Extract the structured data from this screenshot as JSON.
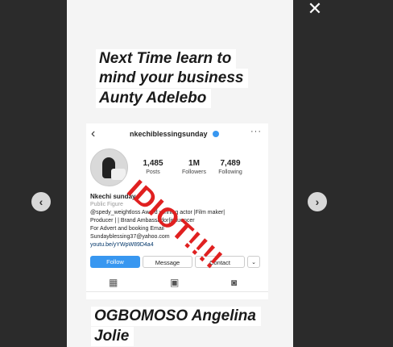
{
  "story": {
    "caption_top": [
      "Next Time learn to",
      "mind your business",
      "Aunty Adelebo"
    ],
    "caption_bottom": [
      "OGBOMOSO Angelina",
      "Jolie"
    ],
    "stamp_text": "IDIOT!!!!"
  },
  "profile": {
    "handle": "nkechiblessingsunday",
    "back_glyph": "‹",
    "more_glyph": "···",
    "stats": [
      {
        "value": "1,485",
        "label": "Posts"
      },
      {
        "value": "1M",
        "label": "Followers"
      },
      {
        "value": "7,489",
        "label": "Following"
      }
    ],
    "name": "Nkechi sunday",
    "category": "Public Figure",
    "bio_lines": [
      "@spedy_weightloss Award winning actor |Film maker|",
      "Producer |  | Brand Ambassador|influencer",
      "For Advert and booking Email",
      "Sundayblessing37@yahoo.com"
    ],
    "link": "youtu.be/yYWpW89D4a4",
    "buttons": {
      "follow": "Follow",
      "message": "Message",
      "contact": "Contact",
      "more": "⌄"
    },
    "tabs": {
      "grid": "▦",
      "igtv": "▣",
      "tagged": "◙"
    }
  },
  "viewer": {
    "prev": "‹",
    "next": "›",
    "close": "✕"
  },
  "colors": {
    "accent": "#3897f0",
    "stamp": "#e02020",
    "background": "#2b2b2b"
  }
}
